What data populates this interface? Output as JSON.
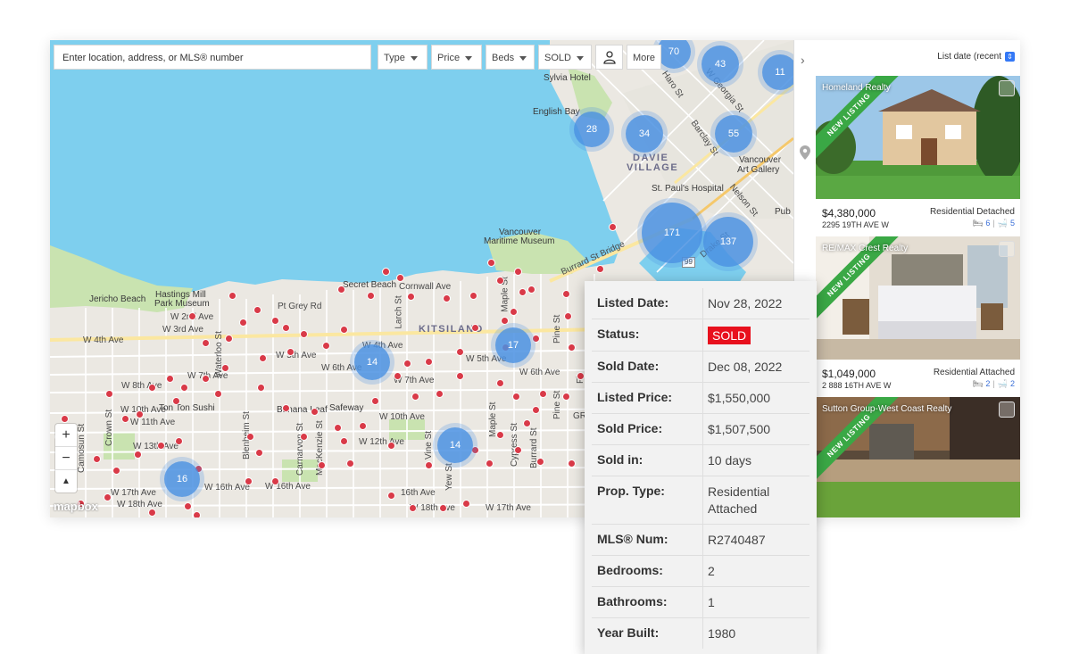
{
  "search": {
    "placeholder": "Enter location, address, or MLS® number"
  },
  "filters": {
    "type": "Type",
    "price": "Price",
    "beds": "Beds",
    "status": "SOLD",
    "more": "More"
  },
  "map": {
    "attribution": "mapbox",
    "clusters": [
      "70",
      "43",
      "11",
      "28",
      "34",
      "55",
      "171",
      "137",
      "17",
      "14",
      "14",
      "16"
    ],
    "labels": {
      "sylvia": "Sylvia Hotel",
      "english_bay": "English Bay",
      "davie": "DAVIE",
      "village": "VILLAGE",
      "stpauls": "St. Paul's Hospital",
      "vag1": "Vancouver",
      "vag2": "Art Gallery",
      "haro": "Haro St",
      "georgia": "W Georgia St",
      "barclay": "Barclay St",
      "nelson": "Nelson St",
      "drake": "Drake St",
      "pub": "Pub",
      "vmm1": "Vancouver",
      "vmm2": "Maritime Museum",
      "burrard_bridge": "Burrard St Bridge",
      "jericho": "Jericho Beach",
      "hm1": "Hastings Mill",
      "hm2": "Park Museum",
      "w2nd": "W 2nd Ave",
      "w3rd": "W 3rd Ave",
      "ptgrey": "Pt Grey Rd",
      "secret": "Secret Beach",
      "cornwall": "Cornwall Ave",
      "larch": "Larch St",
      "maple": "Maple St",
      "kitsilano": "KITSILANO",
      "w4th": "W 4th Ave",
      "w4th2": "W 4th Ave",
      "w5th": "W 5th Ave",
      "w5th2": "W 5th Ave",
      "w6th": "W 6th Ave",
      "w6th2": "W 6th Ave",
      "w7th": "W 7th Ave",
      "w7th2": "W 7th Ave",
      "w8th": "W 8th Ave",
      "w10th": "W 10th Ave",
      "w10th2": "W 10th Ave",
      "w11th": "W 11th Ave",
      "w12th": "W 12th Ave",
      "w13th": "W 13th Ave",
      "w16th": "W 16th Ave",
      "w16th2": "W 16th Ave",
      "w16th3": "16th Ave",
      "w17th": "W 17th Ave",
      "w18th": "W 18th Ave",
      "w18th2": "W 18th Ave",
      "w17th2": "W 17th Ave",
      "tonton": "Ton Ton Sushi",
      "banana": "Banana Leaf",
      "safeway": "Safeway",
      "waterloo": "Waterloo St",
      "blenheim": "Blenheim St",
      "carnarvon": "Carnarvon St",
      "mackenzie": "MacKenzie St",
      "vine": "Vine St",
      "yew": "Yew St",
      "maple2": "Maple St",
      "cypress": "Cypress St",
      "burrard": "Burrard St",
      "pine": "Pine St",
      "pine2": "Pine St",
      "crown": "Crown St",
      "camosun": "Camosun St",
      "fir": "Fir",
      "gr": "GR",
      "num99": "99"
    }
  },
  "sort": {
    "label": "List date (recent"
  },
  "listings": [
    {
      "agency": "Homeland Realty",
      "ribbon": "NEW LISTING",
      "price": "$4,380,000",
      "ptype": "Residential Detached",
      "address": "2295 19TH AVE W",
      "beds": "6",
      "baths": "5"
    },
    {
      "agency": "RE/MAX Crest Realty",
      "ribbon": "NEW LISTING",
      "price": "$1,049,000",
      "ptype": "Residential Attached",
      "address": "2 888 16TH AVE W",
      "beds": "2",
      "baths": "2"
    },
    {
      "agency": "Sutton Group-West Coast Realty",
      "ribbon": "NEW LISTING"
    }
  ],
  "details": {
    "listed_date": {
      "label": "Listed Date:",
      "value": "Nov 28, 2022"
    },
    "status": {
      "label": "Status:",
      "value": "SOLD"
    },
    "sold_date": {
      "label": "Sold Date:",
      "value": "Dec 08, 2022"
    },
    "listed_price": {
      "label": "Listed Price:",
      "value": "$1,550,000"
    },
    "sold_price": {
      "label": "Sold Price:",
      "value": "$1,507,500"
    },
    "sold_in": {
      "label": "Sold in:",
      "value": "10 days"
    },
    "prop_type": {
      "label": "Prop. Type:",
      "value1": "Residential",
      "value2": "Attached"
    },
    "mls": {
      "label": "MLS® Num:",
      "value": "R2740487"
    },
    "bedrooms": {
      "label": "Bedrooms:",
      "value": "2"
    },
    "bathrooms": {
      "label": "Bathrooms:",
      "value": "1"
    },
    "year_built": {
      "label": "Year Built:",
      "value": "1980"
    }
  },
  "colors": {
    "water": "#7ecfee",
    "park": "#c9e3b0",
    "cluster": "#4a90e2",
    "marker": "#d93a48",
    "sold": "#e8101d",
    "ribbon": "#3aa845"
  }
}
